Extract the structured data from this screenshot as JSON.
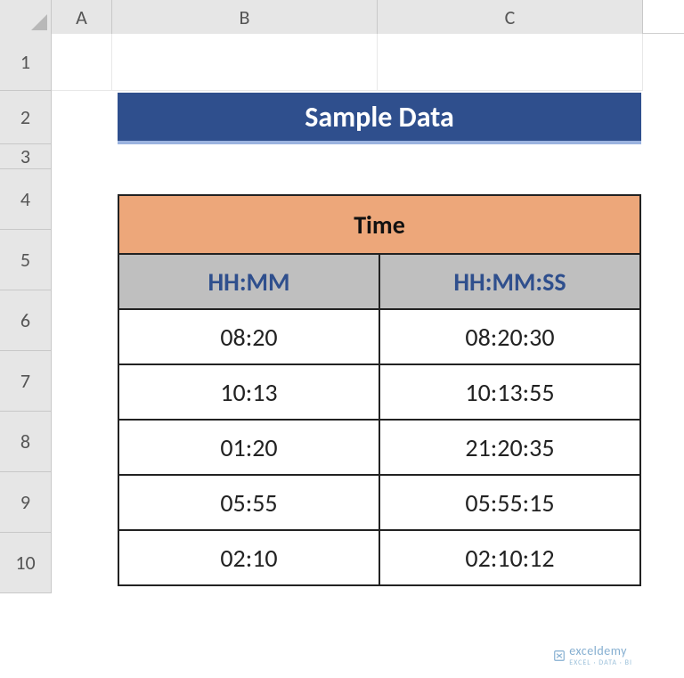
{
  "columns": {
    "A": "A",
    "B": "B",
    "C": "C"
  },
  "rows": {
    "r1": "1",
    "r2": "2",
    "r3": "3",
    "r4": "4",
    "r5": "5",
    "r6": "6",
    "r7": "7",
    "r8": "8",
    "r9": "9",
    "r10": "10"
  },
  "title": "Sample Data",
  "table": {
    "time_header": "Time",
    "col_b_header": "HH:MM",
    "col_c_header": "HH:MM:SS",
    "rows": [
      {
        "hhmm": "08:20",
        "hhmmss": "08:20:30"
      },
      {
        "hhmm": "10:13",
        "hhmmss": "10:13:55"
      },
      {
        "hhmm": "01:20",
        "hhmmss": "21:20:35"
      },
      {
        "hhmm": "05:55",
        "hhmmss": "05:55:15"
      },
      {
        "hhmm": "02:10",
        "hhmmss": "02:10:12"
      }
    ]
  },
  "watermark": {
    "brand": "exceldemy",
    "tagline": "EXCEL · DATA · BI"
  },
  "chart_data": {
    "type": "table",
    "title": "Sample Data",
    "columns": [
      "HH:MM",
      "HH:MM:SS"
    ],
    "rows": [
      [
        "08:20",
        "08:20:30"
      ],
      [
        "10:13",
        "10:13:55"
      ],
      [
        "01:20",
        "21:20:35"
      ],
      [
        "05:55",
        "05:55:15"
      ],
      [
        "02:10",
        "02:10:12"
      ]
    ]
  }
}
